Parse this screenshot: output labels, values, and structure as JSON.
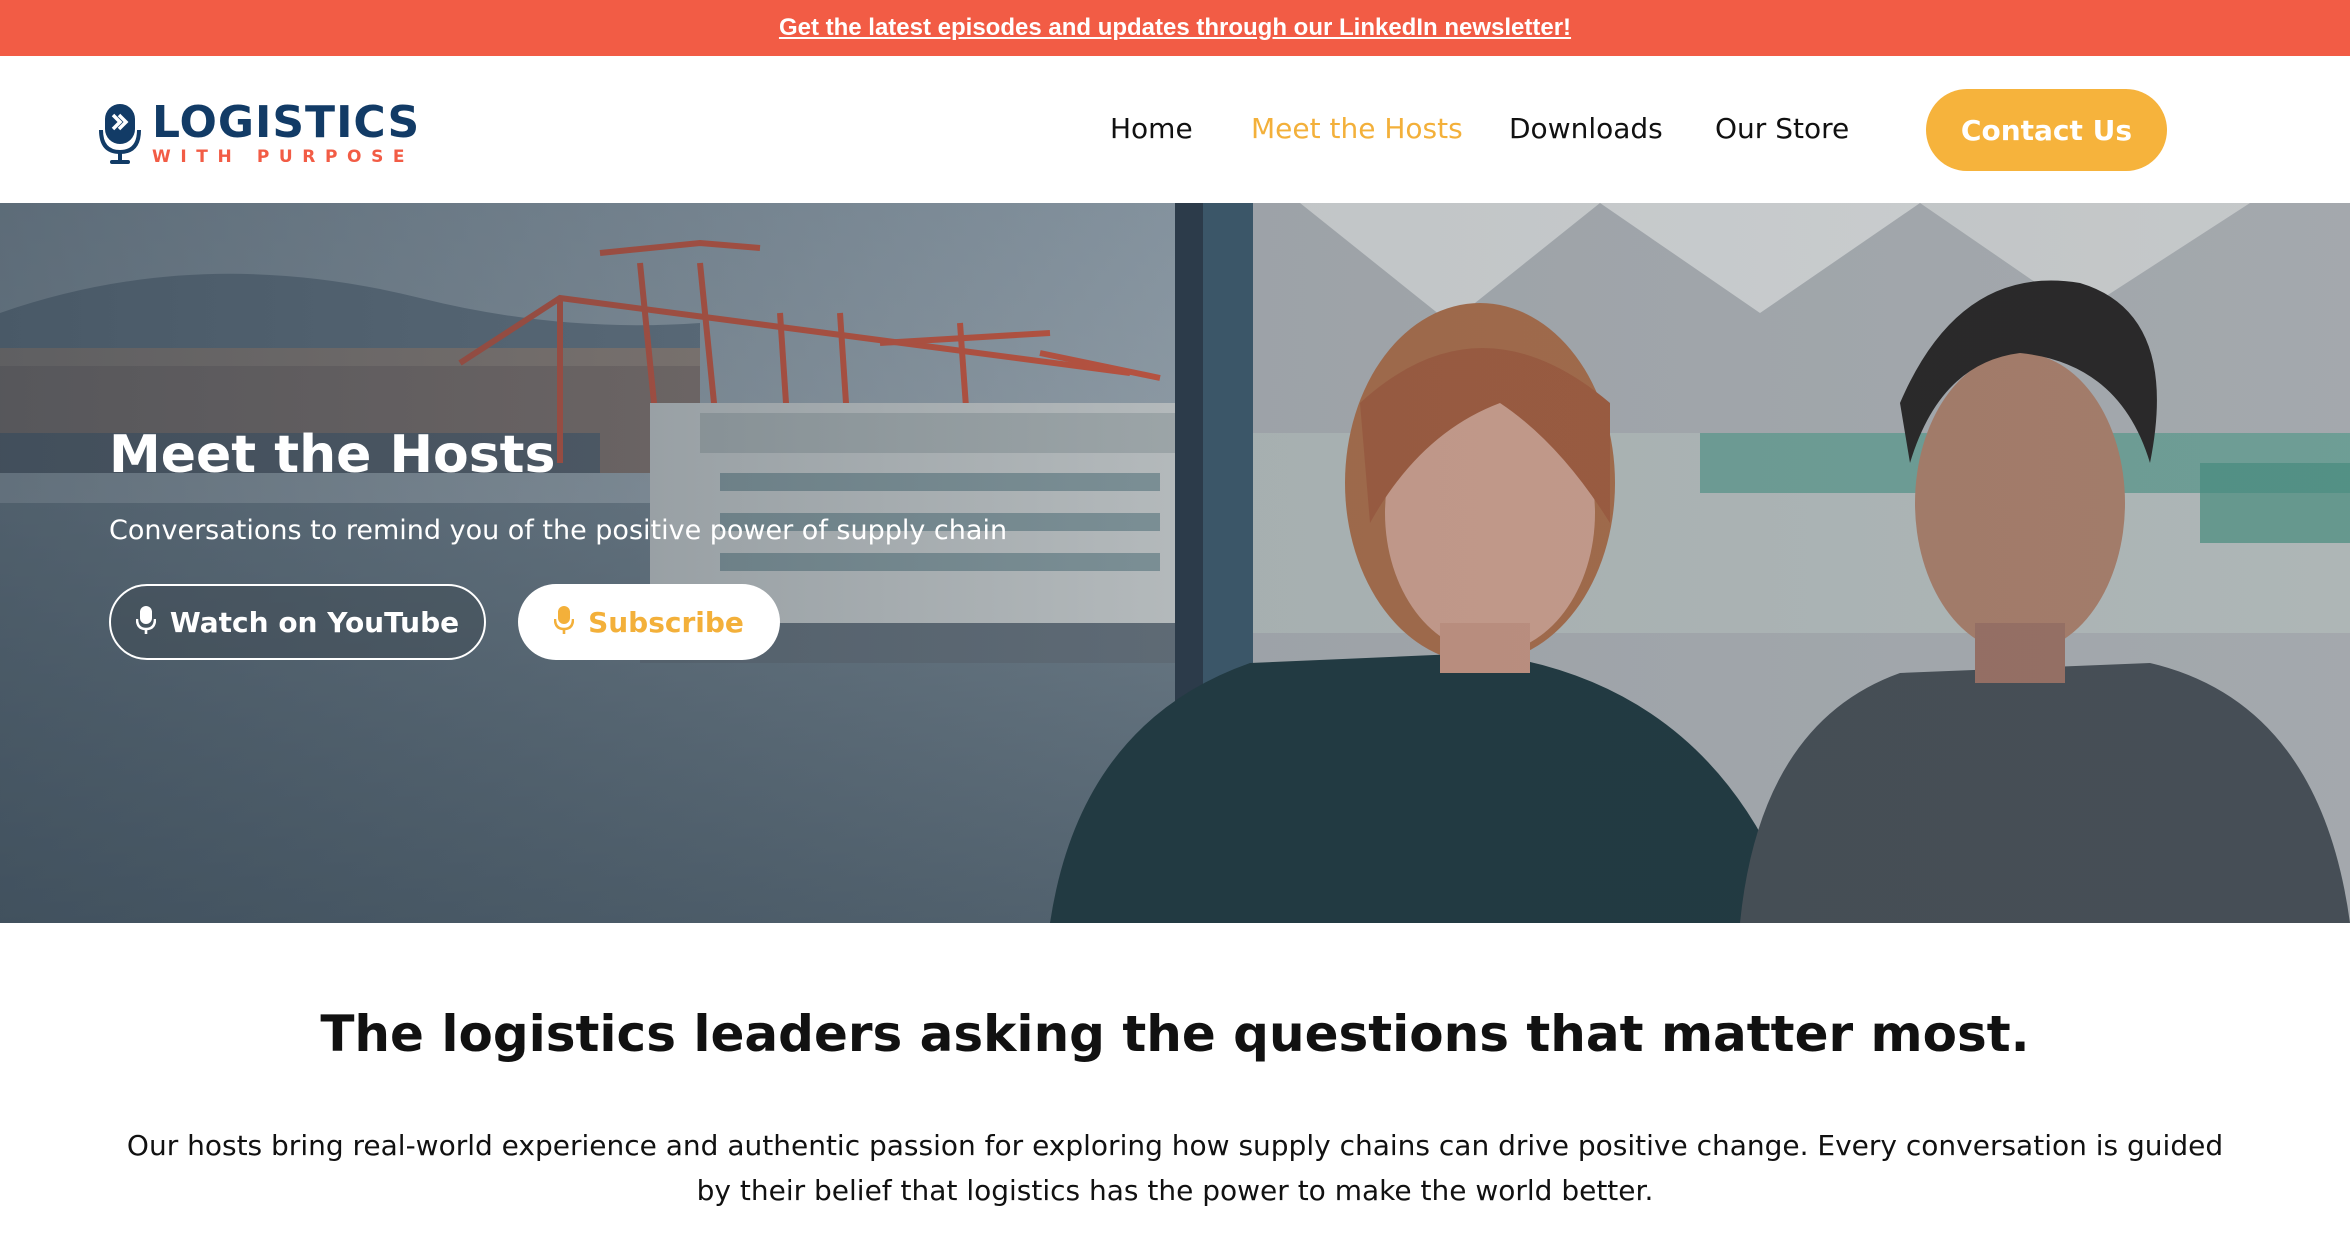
{
  "announcement": {
    "text": "Get the latest episodes and updates through our LinkedIn newsletter!"
  },
  "brand": {
    "name": "LOGISTICS",
    "tagline": "WITH PURPOSE"
  },
  "nav": {
    "items": [
      {
        "label": "Home",
        "active": false
      },
      {
        "label": "Meet the Hosts",
        "active": true
      },
      {
        "label": "Downloads",
        "active": false
      },
      {
        "label": "Our Store",
        "active": false
      }
    ],
    "contact_label": "Contact Us"
  },
  "hero": {
    "title": "Meet the Hosts",
    "subtitle": "Conversations to remind you of the positive power of supply chain",
    "youtube_label": "Watch on YouTube",
    "subscribe_label": "Subscribe",
    "youtube_icon": "microphone-icon",
    "subscribe_icon": "microphone-icon"
  },
  "intro": {
    "heading": "The logistics leaders asking the questions that matter most.",
    "body": "Our hosts bring real-world experience and authentic passion for exploring how supply chains can drive positive change. Every conversation is guided by their belief that logistics has the power to make the world better."
  },
  "colors": {
    "announcement_bg": "#f25c45",
    "brand_navy": "#123b66",
    "brand_coral": "#f25c45",
    "accent_yellow": "#f6b33c"
  }
}
